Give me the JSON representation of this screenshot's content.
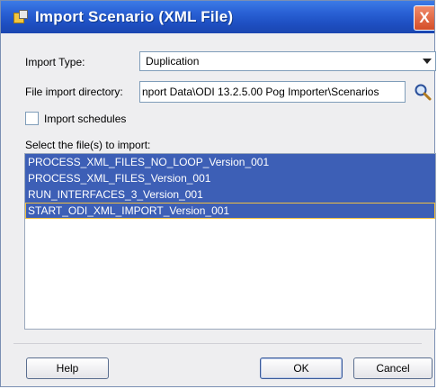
{
  "window": {
    "title": "Import Scenario (XML File)",
    "close_glyph": "X"
  },
  "import_type": {
    "label": "Import Type:",
    "value": "Duplication"
  },
  "file_directory": {
    "label": "File import directory:",
    "value": "nport Data\\ODI 13.2.5.00 Pog Importer\\Scenarios"
  },
  "import_schedules": {
    "label": "Import schedules",
    "checked": false
  },
  "file_list": {
    "label": "Select the file(s) to import:",
    "items": [
      "PROCESS_XML_FILES_NO_LOOP_Version_001",
      "PROCESS_XML_FILES_Version_001",
      "RUN_INTERFACES_3_Version_001",
      "START_ODI_XML_IMPORT_Version_001"
    ]
  },
  "buttons": {
    "help": "Help",
    "ok": "OK",
    "cancel": "Cancel"
  },
  "colors": {
    "titlebar": "#2a62d6",
    "selection": "#3d5fb6",
    "close": "#d44e28"
  },
  "icons": {
    "title": "import-scenario-icon",
    "browse": "magnifier-icon",
    "dropdown": "chevron-down-icon"
  }
}
